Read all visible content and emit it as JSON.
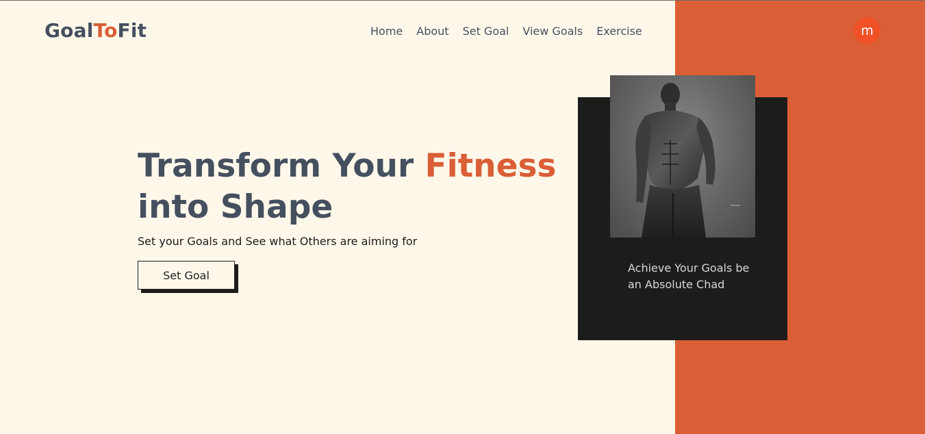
{
  "brand": {
    "part1": "Goal",
    "part2": "To",
    "part3": "Fit",
    "accent_color": "#DA5E36",
    "text_color": "#45505F"
  },
  "nav": {
    "items": [
      "Home",
      "About",
      "Set Goal",
      "View Goals",
      "Exercise"
    ]
  },
  "user": {
    "avatar_initial": "m",
    "avatar_color": "#F05127"
  },
  "hero": {
    "title_part1": "Transform Your ",
    "title_accent": "Fitness",
    "title_part2": "into Shape",
    "subtitle": "Set your Goals and See what Others are aiming for",
    "cta_label": "Set Goal"
  },
  "card": {
    "photo": "grayscale bodybuilder photo",
    "caption": "Achieve Your Goals be an Absolute Chad"
  },
  "colors": {
    "background": "#FFF8EA",
    "panel": "#DA5E36",
    "card": "#1C1C1C"
  }
}
